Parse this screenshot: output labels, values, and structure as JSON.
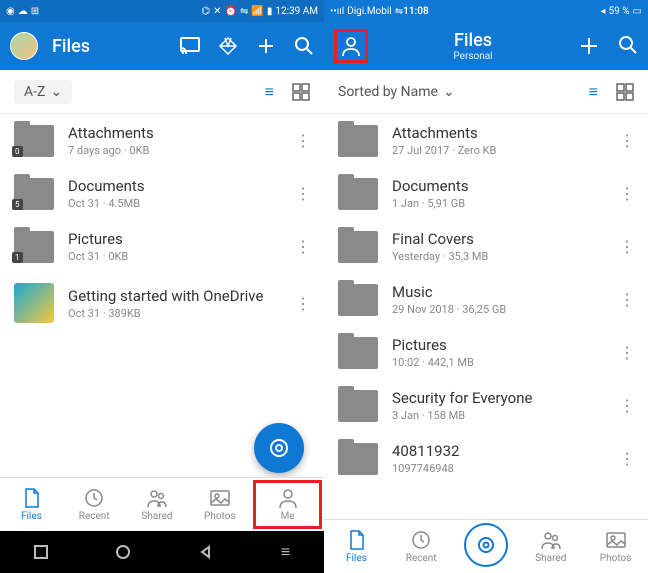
{
  "android": {
    "status": {
      "time": "12:39 AM"
    },
    "header": {
      "title": "Files"
    },
    "sort": {
      "label": "A-Z"
    },
    "items": [
      {
        "name": "Attachments",
        "meta": "7 days ago · 0KB",
        "badge": "0"
      },
      {
        "name": "Documents",
        "meta": "Oct 31 · 4.5MB",
        "badge": "5"
      },
      {
        "name": "Pictures",
        "meta": "Oct 31 · 0KB",
        "badge": "1"
      },
      {
        "name": "Getting started with OneDrive",
        "meta": "Oct 31 · 389KB",
        "thumb": true
      }
    ],
    "tabs": [
      {
        "label": "Files",
        "active": true
      },
      {
        "label": "Recent"
      },
      {
        "label": "Shared"
      },
      {
        "label": "Photos"
      },
      {
        "label": "Me",
        "highlight": true
      }
    ]
  },
  "ios": {
    "status": {
      "carrier": "Digi.Mobil",
      "time": "11:08",
      "battery": "59 %"
    },
    "header": {
      "title": "Files",
      "subtitle": "Personal"
    },
    "sort": {
      "label": "Sorted by Name"
    },
    "items": [
      {
        "name": "Attachments",
        "meta": "27 Jul 2017 · Zero KB"
      },
      {
        "name": "Documents",
        "meta": "1 Jan · 5,91 GB"
      },
      {
        "name": "Final Covers",
        "meta": "Yesterday · 35,3 MB"
      },
      {
        "name": "Music",
        "meta": "29 Nov 2018 · 36,25 GB"
      },
      {
        "name": "Pictures",
        "meta": "10:02 · 442,1 MB"
      },
      {
        "name": "Security for Everyone",
        "meta": "3 Jan · 158 MB"
      },
      {
        "name": "40811932",
        "meta": "1097746948"
      }
    ],
    "tabs": [
      {
        "label": "Files",
        "active": true
      },
      {
        "label": "Recent"
      },
      {
        "label": ""
      },
      {
        "label": "Shared"
      },
      {
        "label": "Photos"
      }
    ]
  }
}
